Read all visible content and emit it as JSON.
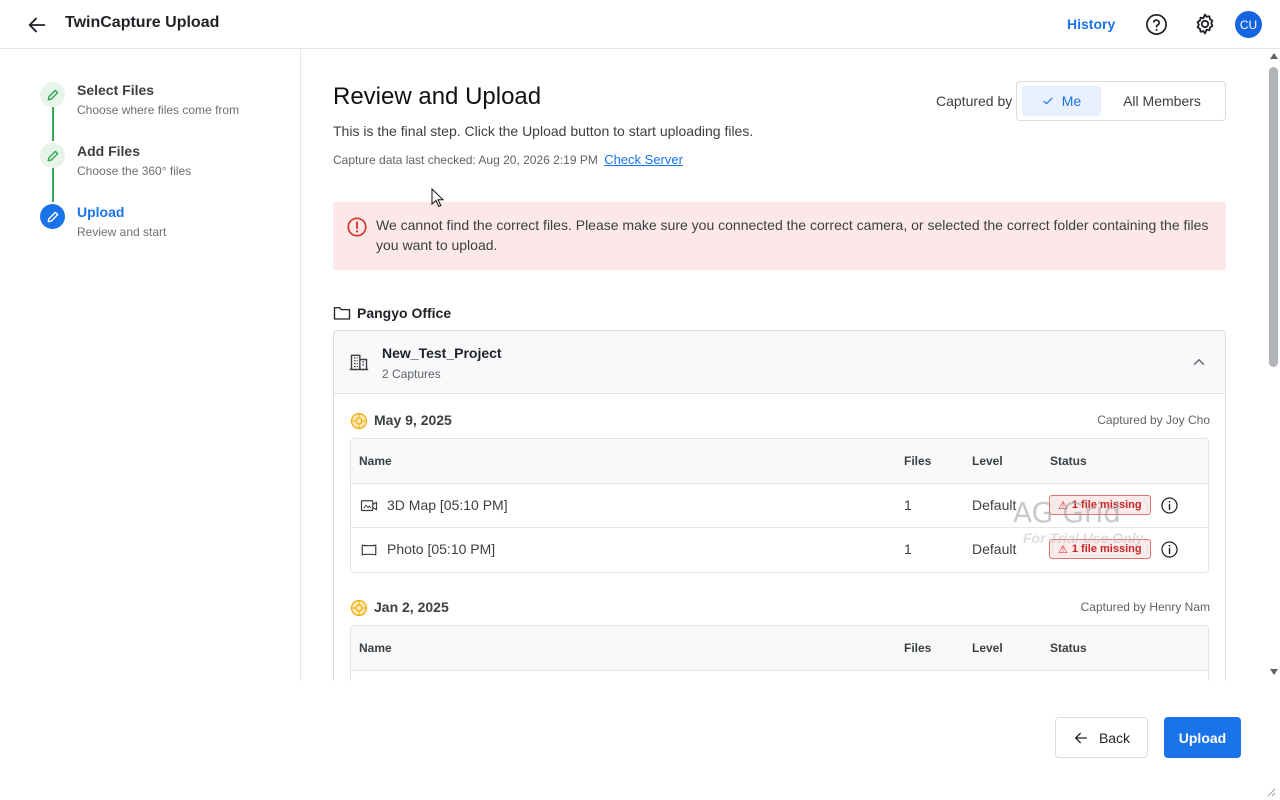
{
  "header": {
    "title": "TwinCapture Upload",
    "history_label": "History",
    "avatar_initials": "CU"
  },
  "steps": [
    {
      "label": "Select Files",
      "sub": "Choose where files come from",
      "state": "done"
    },
    {
      "label": "Add Files",
      "sub": "Choose the 360° files",
      "state": "done"
    },
    {
      "label": "Upload",
      "sub": "Review and start",
      "state": "active"
    }
  ],
  "main": {
    "title": "Review and Upload",
    "description": "This is the final step. Click the Upload button to start uploading files.",
    "checked_text": "Capture data last checked: Aug 20, 2026 2:19 PM",
    "check_server_label": "Check Server",
    "captured_by_label": "Captured by",
    "captured_by_options": [
      "Me",
      "All Members"
    ],
    "captured_by_selected": "Me",
    "alert": "We cannot find the correct files. Please make sure you connected the correct camera, or selected the correct folder containing the files you want to upload.",
    "office_name": "Pangyo Office",
    "project": {
      "name": "New_Test_Project",
      "count": "2 Captures"
    },
    "columns": [
      "Name",
      "Files",
      "Level",
      "Status"
    ],
    "groups": [
      {
        "date": "May 9, 2025",
        "captured_by": "Captured by Joy Cho",
        "rows": [
          {
            "name": "3D Map [05:10 PM]",
            "files": "1",
            "level": "Default",
            "status": "1 file missing",
            "icon": "map-video-icon"
          },
          {
            "name": "Photo [05:10 PM]",
            "files": "1",
            "level": "Default",
            "status": "1 file missing",
            "icon": "photo-frame-icon"
          }
        ]
      },
      {
        "date": "Jan 2, 2025",
        "captured_by": "Captured by Henry Nam",
        "rows": []
      }
    ],
    "watermark": {
      "main": "AG Grid",
      "sub": "For Trial Use Only"
    }
  },
  "footer": {
    "back_label": "Back",
    "upload_label": "Upload"
  },
  "colors": {
    "accent": "#1a73e8",
    "error_bg": "#fce8e8",
    "error_text": "#c62828",
    "done_green": "#34a853"
  }
}
